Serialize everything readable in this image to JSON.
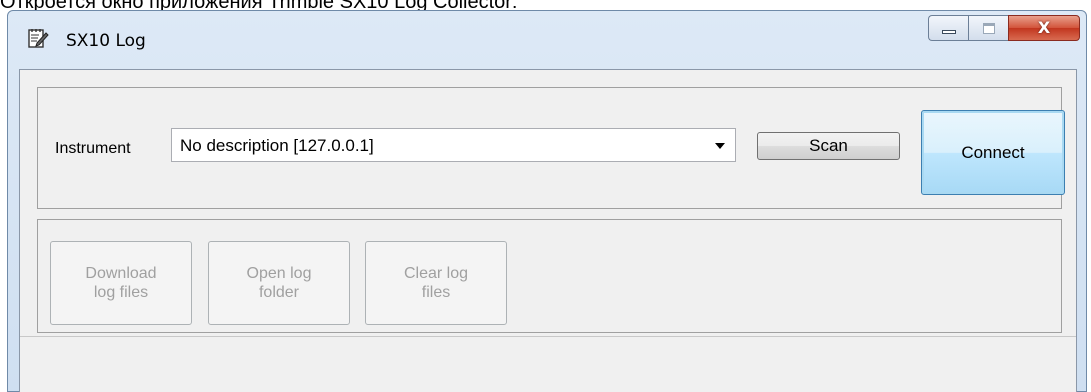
{
  "page_caption": "Откроется окно приложения Trimble SX10 Log Collector:",
  "window": {
    "title": "SX10 Log",
    "app_icon": "notepad-pencil-icon",
    "controls": {
      "minimize": "minimize-icon",
      "maximize": "maximize-icon",
      "close_glyph": "X"
    }
  },
  "instrument": {
    "label": "Instrument",
    "selected": "No description [127.0.0.1]",
    "scan_label": "Scan",
    "connect_label": "Connect"
  },
  "actions": {
    "download_line1": "Download",
    "download_line2": "log files",
    "open_line1": "Open log",
    "open_line2": "folder",
    "clear_line1": "Clear log",
    "clear_line2": "files"
  },
  "status": {
    "text": ""
  }
}
